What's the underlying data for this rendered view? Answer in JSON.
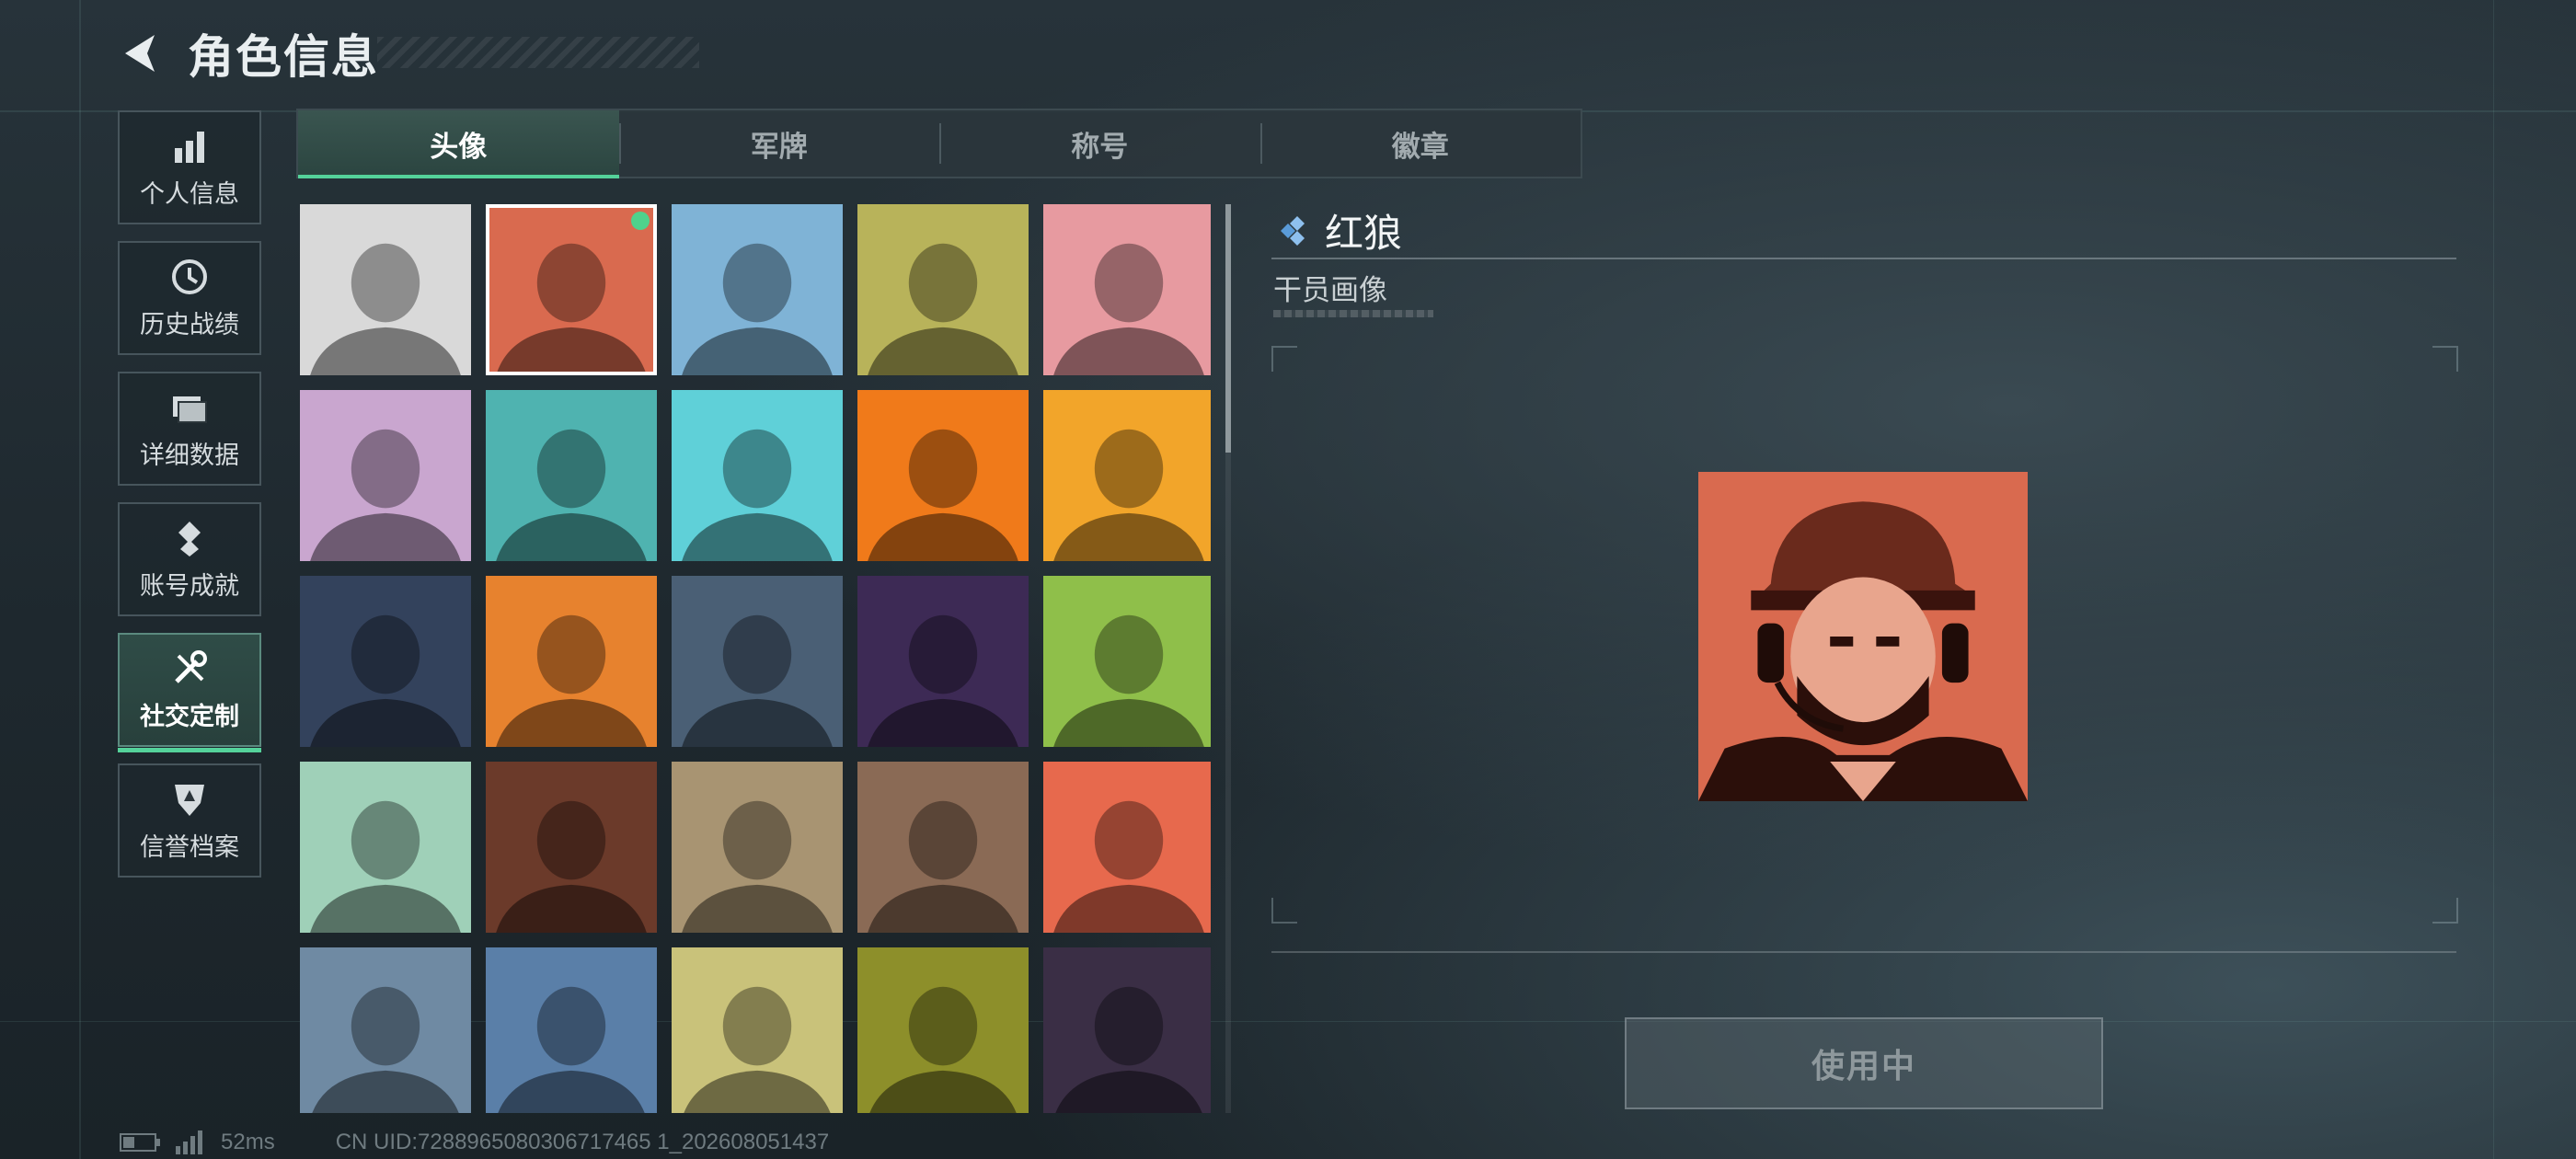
{
  "header": {
    "title": "角色信息"
  },
  "sidebar": {
    "items": [
      {
        "label": "个人信息",
        "icon": "bar-chart-icon"
      },
      {
        "label": "历史战绩",
        "icon": "clock-history-icon"
      },
      {
        "label": "详细数据",
        "icon": "folder-icon"
      },
      {
        "label": "账号成就",
        "icon": "achievement-icon"
      },
      {
        "label": "社交定制",
        "icon": "tools-icon",
        "active": true
      },
      {
        "label": "信誉档案",
        "icon": "shield-badge-icon"
      }
    ]
  },
  "tabs": [
    {
      "label": "头像",
      "active": true
    },
    {
      "label": "军牌"
    },
    {
      "label": "称号"
    },
    {
      "label": "徽章"
    }
  ],
  "avatars": [
    {
      "name": "red-haired-woman-bw-portrait",
      "bg": "#d9d9d9"
    },
    {
      "name": "red-wolf-operator-portrait",
      "bg": "#d96a4f",
      "selected": true,
      "equipped": true
    },
    {
      "name": "pilot-with-goggles-portrait",
      "bg": "#7fb3d6"
    },
    {
      "name": "bald-soldier-headset-portrait",
      "bg": "#b8b35a"
    },
    {
      "name": "helmet-soldier-pink-portrait",
      "bg": "#e79aa0"
    },
    {
      "name": "white-haired-girl-portrait",
      "bg": "#c9a6cf"
    },
    {
      "name": "bearded-glasses-teal-portrait",
      "bg": "#4fb3b0"
    },
    {
      "name": "masked-helmet-cyan-portrait",
      "bg": "#5fd0d8"
    },
    {
      "name": "masked-man-orange-portrait",
      "bg": "#f07a1a"
    },
    {
      "name": "triangle-emblem-portrait",
      "bg": "#f2a52a"
    },
    {
      "name": "night-soldier-portrait",
      "bg": "#33425c"
    },
    {
      "name": "commando-holding-drone-portrait",
      "bg": "#e7822e"
    },
    {
      "name": "sniper-scope-portrait",
      "bg": "#4a5f75"
    },
    {
      "name": "card-burst-portrait",
      "bg": "#3d2a55"
    },
    {
      "name": "exit-doorway-portrait",
      "bg": "#8fbf4a"
    },
    {
      "name": "way-out-sign-portrait",
      "bg": "#9fd0b8"
    },
    {
      "name": "orange-feather-portrait",
      "bg": "#6b3a2a"
    },
    {
      "name": "wasteland-truck-portrait",
      "bg": "#a89472"
    },
    {
      "name": "scales-emblem-portrait",
      "bg": "#8a6a55"
    },
    {
      "name": "red-haired-woman-portrait",
      "bg": "#e7694d"
    },
    {
      "name": "mountain-scout-portrait",
      "bg": "#6f8aa3"
    },
    {
      "name": "archer-woman-portrait",
      "bg": "#5a7fa8"
    },
    {
      "name": "beware-of-alligator-sign-portrait",
      "bg": "#c9c27a"
    },
    {
      "name": "glasses-man-olive-portrait",
      "bg": "#8d8f2a"
    },
    {
      "name": "goggles-masked-man-portrait",
      "bg": "#3a2e45"
    }
  ],
  "detail": {
    "name": "红狼",
    "type": "干员画像",
    "button_label": "使用中",
    "button_state": "disabled"
  },
  "status_bar": {
    "ping": "52ms",
    "uid": "CN UID:7288965080306717465 1_202608051437"
  },
  "colors": {
    "accent": "#54d29a",
    "equipped_dot": "#4ed28c",
    "rarity": "#5a9bd8"
  }
}
